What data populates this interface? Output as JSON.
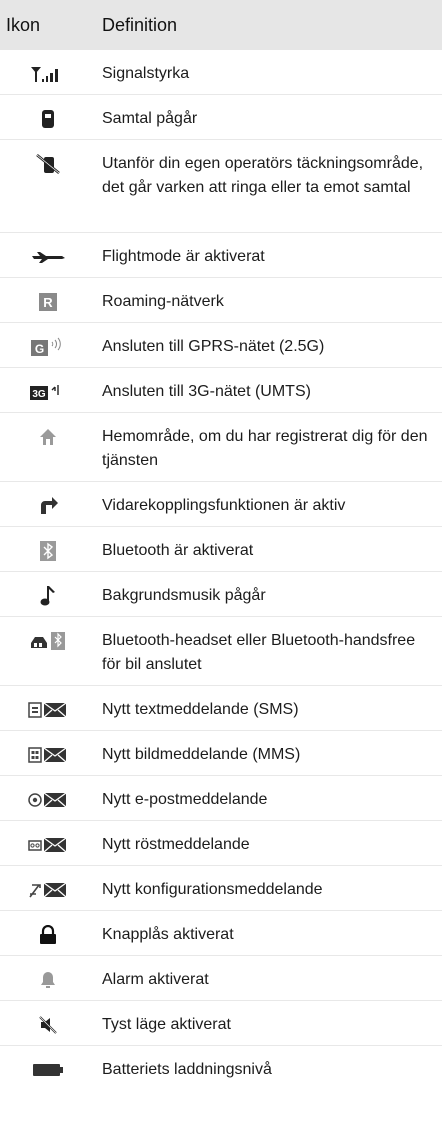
{
  "header": {
    "col_icon": "Ikon",
    "col_definition": "Definition"
  },
  "rows": [
    {
      "icon": "signal-strength-icon",
      "text": "Signalstyrka"
    },
    {
      "icon": "call-in-progress-icon",
      "text": "Samtal pågår"
    },
    {
      "icon": "no-network-icon",
      "text": "Utanför din egen operatörs täckningsområde, det går varken att ringa eller ta emot samtal"
    },
    {
      "icon": "airplane-icon",
      "text": "Flightmode är aktiverat"
    },
    {
      "icon": "roaming-icon",
      "text": "Roaming-nätverk"
    },
    {
      "icon": "gprs-icon",
      "text": "Ansluten till GPRS-nätet (2.5G)"
    },
    {
      "icon": "3g-icon",
      "text": "Ansluten till 3G-nätet (UMTS)"
    },
    {
      "icon": "home-zone-icon",
      "text": "Hemområde, om du har registrerat dig för den tjänsten"
    },
    {
      "icon": "call-forward-icon",
      "text": "Vidarekopplingsfunktionen är aktiv"
    },
    {
      "icon": "bluetooth-icon",
      "text": "Bluetooth är aktiverat"
    },
    {
      "icon": "music-note-icon",
      "text": "Bakgrundsmusik pågår"
    },
    {
      "icon": "bluetooth-headset-icon",
      "text": "Bluetooth-headset eller Bluetooth-handsfree för bil anslutet"
    },
    {
      "icon": "sms-icon",
      "text": "Nytt textmeddelande (SMS)"
    },
    {
      "icon": "mms-icon",
      "text": "Nytt bildmeddelande (MMS)"
    },
    {
      "icon": "email-icon",
      "text": "Nytt e-postmeddelande"
    },
    {
      "icon": "voicemail-icon",
      "text": "Nytt röstmeddelande"
    },
    {
      "icon": "config-message-icon",
      "text": "Nytt konfigurationsmeddelande"
    },
    {
      "icon": "keylock-icon",
      "text": "Knapplås aktiverat"
    },
    {
      "icon": "alarm-bell-icon",
      "text": "Alarm aktiverat"
    },
    {
      "icon": "silent-mode-icon",
      "text": "Tyst läge aktiverat"
    },
    {
      "icon": "battery-icon",
      "text": "Batteriets laddningsnivå"
    }
  ]
}
